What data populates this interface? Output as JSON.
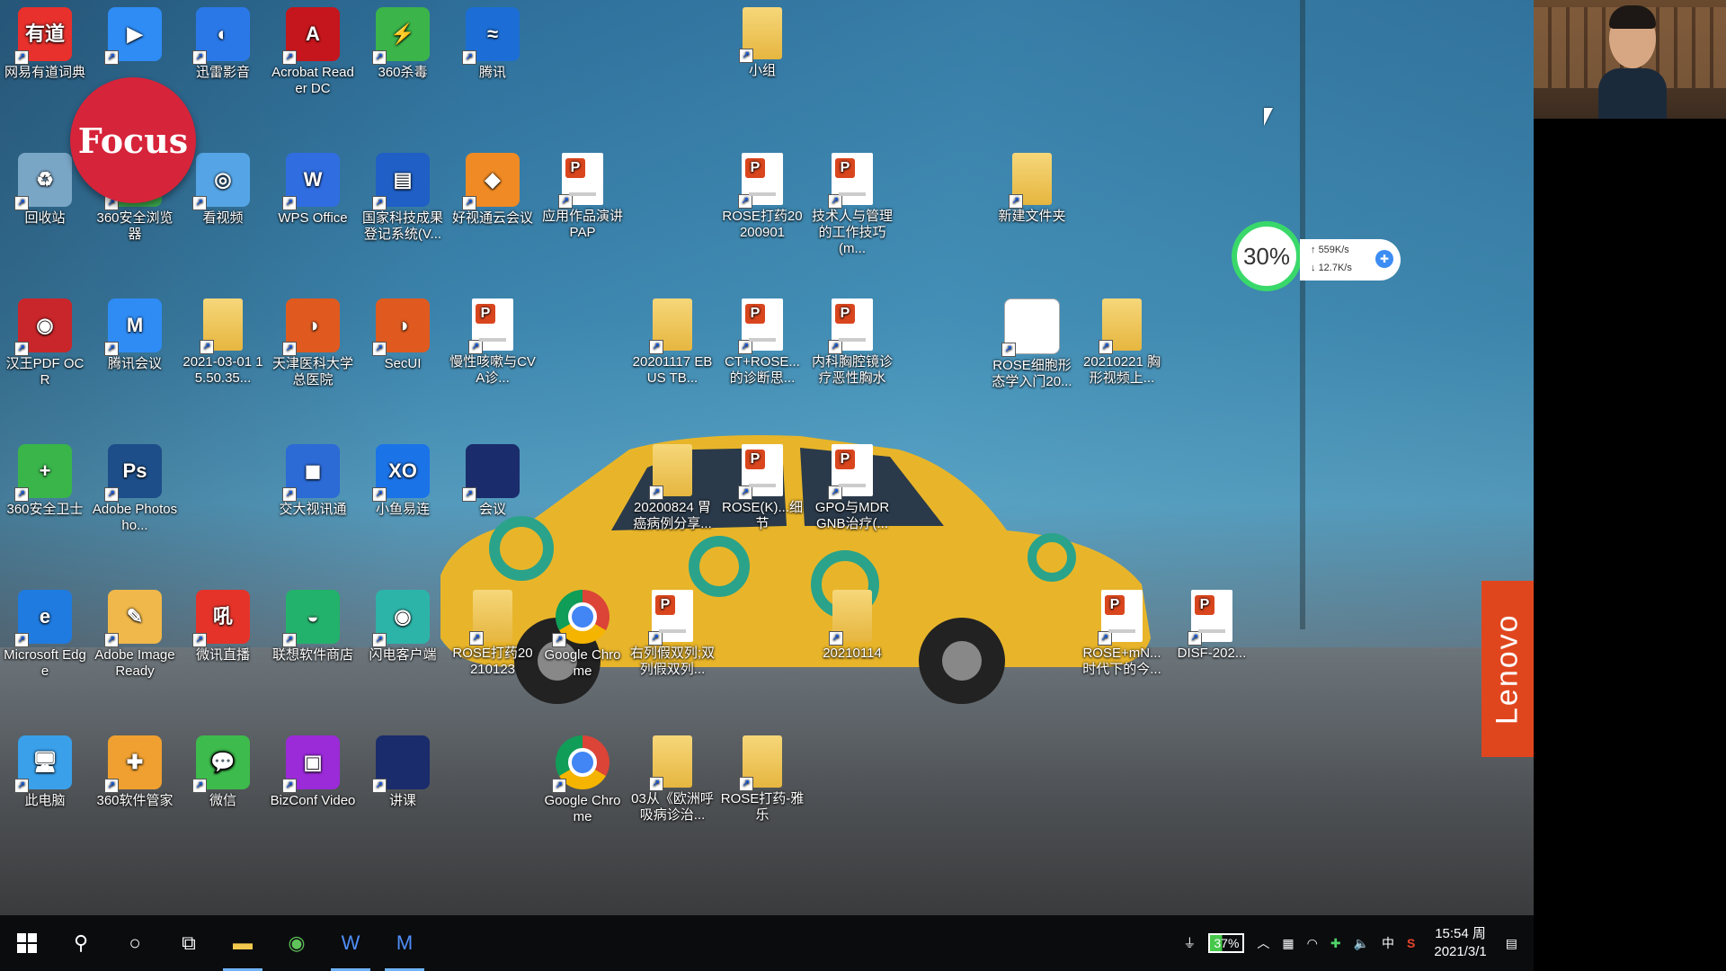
{
  "desktop": {
    "icons": [
      {
        "label": "网易有道词典",
        "icon": "youdao-dict-icon",
        "color": "#e8302c",
        "glyph": "有道"
      },
      {
        "label": "",
        "icon": "video-meeting-icon",
        "color": "#2f8cf5",
        "glyph": "▶"
      },
      {
        "label": "迅雷影音",
        "icon": "xunlei-player-icon",
        "color": "#2a78e8",
        "glyph": "◐"
      },
      {
        "label": "Acrobat Reader DC",
        "icon": "acrobat-icon",
        "color": "#c4161c",
        "glyph": "A"
      },
      {
        "label": "360杀毒",
        "icon": "360-antivirus-icon",
        "color": "#3bb44a",
        "glyph": "⚡"
      },
      {
        "label": "腾讯",
        "icon": "tencent-browser-icon",
        "color": "#1c6ed6",
        "glyph": "≈"
      },
      {
        "label": "小组",
        "icon": "folder-icon",
        "color": "#e9bd4d",
        "glyph": ""
      },
      {
        "label": "回收站",
        "icon": "recycle-bin-icon",
        "color": "#7aa6c6",
        "glyph": "♻"
      },
      {
        "label": "360安全浏览器",
        "icon": "360-browser-icon",
        "color": "#3aa64a",
        "glyph": "e"
      },
      {
        "label": "看视频",
        "icon": "video-player-icon",
        "color": "#55a5e6",
        "glyph": "◎"
      },
      {
        "label": "WPS Office",
        "icon": "wps-office-icon",
        "color": "#2f6de1",
        "glyph": "W"
      },
      {
        "label": "国家科技成果登记系统(V...",
        "icon": "registration-system-icon",
        "color": "#1f5fc6",
        "glyph": "▤"
      },
      {
        "label": "好视通云会议",
        "icon": "haoshitong-icon",
        "color": "#f08a24",
        "glyph": "◆"
      },
      {
        "label": "应用作品演讲PAP",
        "icon": "ppt-file-icon",
        "color": "#ffffff",
        "glyph": ""
      },
      {
        "label": "ROSE打药20200901",
        "icon": "ppt-file-icon",
        "color": "#ffffff",
        "glyph": ""
      },
      {
        "label": "技术人与管理的工作技巧(m...",
        "icon": "ppt-file-icon",
        "color": "#ffffff",
        "glyph": ""
      },
      {
        "label": "新建文件夹",
        "icon": "folder-icon",
        "color": "#e9bd4d",
        "glyph": ""
      },
      {
        "label": "汉王PDF OCR",
        "icon": "hanwang-ocr-icon",
        "color": "#c9262b",
        "glyph": "◉"
      },
      {
        "label": "腾讯会议",
        "icon": "tencent-meeting-icon",
        "color": "#2f8cf5",
        "glyph": "M"
      },
      {
        "label": "2021-03-01 15.50.35...",
        "icon": "folder-icon",
        "color": "#f2df9b",
        "glyph": ""
      },
      {
        "label": "天津医科大学总医院",
        "icon": "hospital-browser-icon",
        "color": "#e05a1f",
        "glyph": "◑"
      },
      {
        "label": "SecUI",
        "icon": "secui-icon",
        "color": "#e05a1f",
        "glyph": "◑"
      },
      {
        "label": "慢性咳嗽与CVA诊...",
        "icon": "ppt-file-icon",
        "color": "#ffffff",
        "glyph": ""
      },
      {
        "label": "20201117 EBUS TB...",
        "icon": "folder-icon",
        "color": "#e9bd4d",
        "glyph": ""
      },
      {
        "label": "CT+ROSE...的诊断思...",
        "icon": "ppt-file-icon",
        "color": "#ffffff",
        "glyph": ""
      },
      {
        "label": "内科胸腔镜诊疗恶性胸水",
        "icon": "ppt-file-icon",
        "color": "#ffffff",
        "glyph": ""
      },
      {
        "label": "ROSE细胞形态学入门20...",
        "icon": "document-icon",
        "color": "#ffffff",
        "glyph": ""
      },
      {
        "label": "20210221 胸形视频上...",
        "icon": "folder-icon",
        "color": "#e9bd4d",
        "glyph": ""
      },
      {
        "label": "360安全卫士",
        "icon": "360-security-icon",
        "color": "#39b54a",
        "glyph": "+"
      },
      {
        "label": "Adobe Photosho...",
        "icon": "photoshop-icon",
        "color": "#1d4e89",
        "glyph": "Ps"
      },
      {
        "label": "交大视讯通",
        "icon": "jiaoda-video-icon",
        "color": "#2c6ad6",
        "glyph": "◼"
      },
      {
        "label": "小鱼易连",
        "icon": "xiaoyu-icon",
        "color": "#1b73e8",
        "glyph": "XO"
      },
      {
        "label": "会议",
        "icon": "meeting-thumbnail-icon",
        "color": "#1a2c6b",
        "glyph": ""
      },
      {
        "label": "20200824 胃癌病例分享...",
        "icon": "folder-icon",
        "color": "#e9bd4d",
        "glyph": ""
      },
      {
        "label": "ROSE(K)...细节",
        "icon": "ppt-file-icon",
        "color": "#ffffff",
        "glyph": ""
      },
      {
        "label": "GPO与MDR GNB治疗(...",
        "icon": "ppt-file-icon",
        "color": "#ffffff",
        "glyph": ""
      },
      {
        "label": "Microsoft Edge",
        "icon": "edge-icon",
        "color": "#1f7be0",
        "glyph": "e"
      },
      {
        "label": "Adobe ImageReady",
        "icon": "imageready-icon",
        "color": "#f0b84a",
        "glyph": "✎"
      },
      {
        "label": "微讯直播",
        "icon": "live-stream-icon",
        "color": "#e5332a",
        "glyph": "吼"
      },
      {
        "label": "联想软件商店",
        "icon": "lenovo-store-icon",
        "color": "#23b26b",
        "glyph": "◒"
      },
      {
        "label": "闪电客户端",
        "icon": "flash-client-icon",
        "color": "#2db4a9",
        "glyph": "◉"
      },
      {
        "label": "ROSE打药20210123",
        "icon": "folder-icon",
        "color": "#e9bd4d",
        "glyph": ""
      },
      {
        "label": "Google Chrome",
        "icon": "chrome-icon",
        "color": "#ffffff",
        "glyph": ""
      },
      {
        "label": "右列假双列;双列假双列...",
        "icon": "ppt-file-icon",
        "color": "#ffffff",
        "glyph": ""
      },
      {
        "label": "20210114",
        "icon": "folder-icon",
        "color": "#e9bd4d",
        "glyph": ""
      },
      {
        "label": "ROSE+mN...时代下的今...",
        "icon": "ppt-file-icon",
        "color": "#ffffff",
        "glyph": ""
      },
      {
        "label": "DISF-202...",
        "icon": "ppt-file-icon",
        "color": "#ffffff",
        "glyph": ""
      },
      {
        "label": "此电脑",
        "icon": "this-pc-icon",
        "color": "#3aa0ea",
        "glyph": "🖥"
      },
      {
        "label": "360软件管家",
        "icon": "360-software-manager-icon",
        "color": "#f0a030",
        "glyph": "✚"
      },
      {
        "label": "微信",
        "icon": "wechat-icon",
        "color": "#3dbb4c",
        "glyph": "💬"
      },
      {
        "label": "BizConf Video",
        "icon": "bizconf-icon",
        "color": "#9b2ad8",
        "glyph": "▣"
      },
      {
        "label": "讲课",
        "icon": "lecture-thumbnail-icon",
        "color": "#1a2c6b",
        "glyph": ""
      },
      {
        "label": "Google Chrome",
        "icon": "chrome-icon",
        "color": "#ffffff",
        "glyph": ""
      },
      {
        "label": "03从《欧洲呼吸病诊治...",
        "icon": "folder-icon",
        "color": "#e9bd4d",
        "glyph": ""
      },
      {
        "label": "ROSE打药-雅乐",
        "icon": "folder-icon",
        "color": "#e9bd4d",
        "glyph": ""
      }
    ]
  },
  "focus_logo": {
    "text": "Focus"
  },
  "net_widget": {
    "percent": "30%",
    "up": "559K/s",
    "down": "12.7K/s"
  },
  "brand": {
    "lenovo": "Lenovo"
  },
  "taskbar": {
    "battery": "37%",
    "ime": "中",
    "time": "15:54 周",
    "date": "2021/3/1"
  },
  "colors": {
    "taskbar": "#0b0c0e",
    "accent": "#6fb1f5",
    "battery_green": "#46c84a",
    "lenovo": "#e0461e"
  }
}
